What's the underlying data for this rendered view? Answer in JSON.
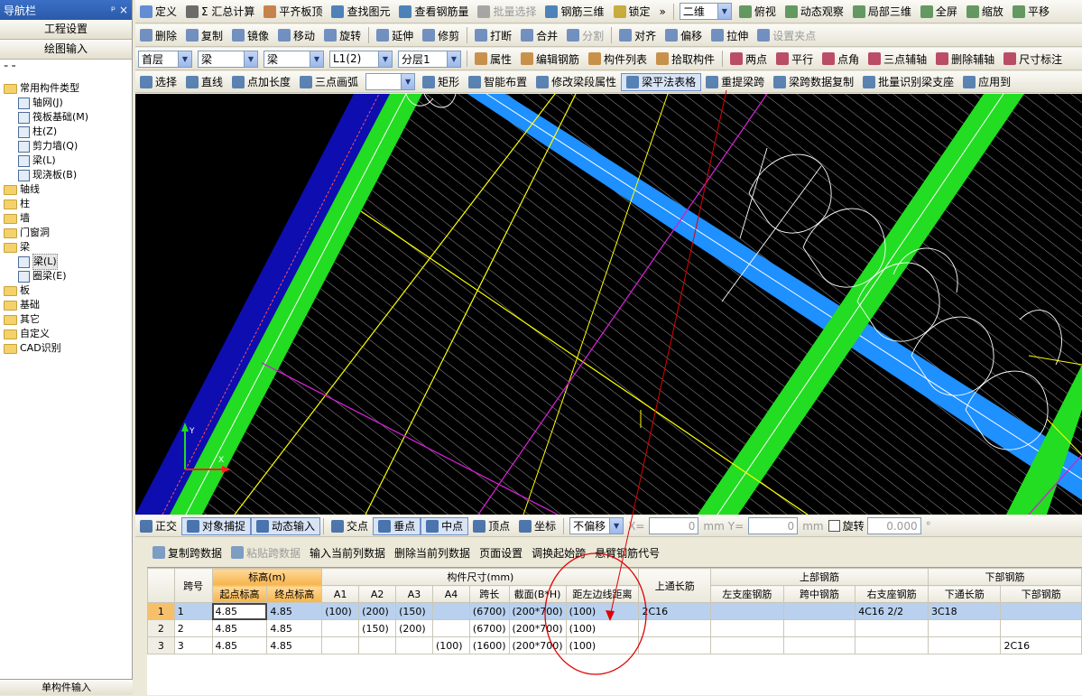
{
  "nav": {
    "title": "导航栏",
    "pin": "ᵖ ×",
    "project_settings": "工程设置",
    "drawing_input": "绘图输入",
    "single_component_input": "单构件输入",
    "tree": [
      {
        "label": "常用构件类型",
        "kind": "folder",
        "level": 0
      },
      {
        "label": "轴网(J)",
        "kind": "item",
        "level": 1
      },
      {
        "label": "筏板基础(M)",
        "kind": "item",
        "level": 1
      },
      {
        "label": "柱(Z)",
        "kind": "item",
        "level": 1
      },
      {
        "label": "剪力墙(Q)",
        "kind": "item",
        "level": 1
      },
      {
        "label": "梁(L)",
        "kind": "item",
        "level": 1
      },
      {
        "label": "现浇板(B)",
        "kind": "item",
        "level": 1
      },
      {
        "label": "轴线",
        "kind": "folder",
        "level": 0
      },
      {
        "label": "柱",
        "kind": "folder",
        "level": 0
      },
      {
        "label": "墙",
        "kind": "folder",
        "level": 0
      },
      {
        "label": "门窗洞",
        "kind": "folder",
        "level": 0
      },
      {
        "label": "梁",
        "kind": "folder",
        "level": 0
      },
      {
        "label": "梁(L)",
        "kind": "item",
        "level": 1,
        "selected": true
      },
      {
        "label": "圈梁(E)",
        "kind": "item",
        "level": 1
      },
      {
        "label": "板",
        "kind": "folder",
        "level": 0
      },
      {
        "label": "基础",
        "kind": "folder",
        "level": 0
      },
      {
        "label": "其它",
        "kind": "folder",
        "level": 0
      },
      {
        "label": "自定义",
        "kind": "folder",
        "level": 0
      },
      {
        "label": "CAD识别",
        "kind": "folder",
        "level": 0
      }
    ]
  },
  "toolbar1": [
    "定义",
    "Σ 汇总计算",
    "平齐板顶",
    "查找图元",
    "查看钢筋量",
    "批量选择",
    "钢筋三维",
    "锁定"
  ],
  "toolbar1_right": {
    "view_combo": "二维",
    "view_items": [
      "俯视",
      "动态观察",
      "局部三维",
      "全屏",
      "缩放",
      "平移"
    ]
  },
  "toolbar2": [
    "删除",
    "复制",
    "镜像",
    "移动",
    "旋转",
    "延伸",
    "修剪",
    "打断",
    "合并",
    "分割",
    "对齐",
    "偏移",
    "拉伸",
    "设置夹点"
  ],
  "toolbar3": {
    "floor": "首层",
    "type": "梁",
    "sub": "梁",
    "component": "L1(2)",
    "layer": "分层1",
    "buttons": [
      "属性",
      "编辑钢筋",
      "构件列表",
      "拾取构件",
      "两点",
      "平行",
      "点角",
      "三点辅轴",
      "删除辅轴",
      "尺寸标注"
    ]
  },
  "toolbar4": [
    "选择",
    "直线",
    "点加长度",
    "三点画弧",
    "矩形",
    "智能布置",
    "修改梁段属性",
    "梁平法表格",
    "重提梁跨",
    "梁跨数据复制",
    "批量识别梁支座",
    "应用到"
  ],
  "snapbar": {
    "items": [
      "正交",
      "对象捕捉",
      "动态输入",
      "交点",
      "垂点",
      "中点",
      "顶点",
      "坐标"
    ],
    "offset": "不偏移",
    "x_label": "X=",
    "x_val": "0",
    "unit": "mm",
    "y_label": "Y=",
    "y_val": "0",
    "rotate": "旋转",
    "rotate_val": "0.000",
    "deg": "°"
  },
  "table_toolbar": [
    "复制跨数据",
    "粘贴跨数据",
    "输入当前列数据",
    "删除当前列数据",
    "页面设置",
    "调换起始跨",
    "悬臂钢筋代号"
  ],
  "table": {
    "h_span": "跨号",
    "h_elev": "标高(m)",
    "h_dim": "构件尺寸(mm)",
    "h_top_through": "上通长筋",
    "h_top": "上部钢筋",
    "h_bottom": "下部钢筋",
    "sub": [
      "起点标高",
      "终点标高",
      "A1",
      "A2",
      "A3",
      "A4",
      "跨长",
      "截面(B*H)",
      "距左边线距离",
      "",
      "左支座钢筋",
      "跨中钢筋",
      "右支座钢筋",
      "下通长筋",
      "下部钢筋"
    ],
    "rows": [
      [
        "1",
        "1",
        "4.85",
        "4.85",
        "(100)",
        "(200)",
        "(150)",
        "",
        "(6700)",
        "(200*700)",
        "(100)",
        "2C16",
        "",
        "",
        "4C16 2/2",
        "3C18",
        ""
      ],
      [
        "2",
        "2",
        "4.85",
        "4.85",
        "",
        "(150)",
        "(200)",
        "",
        "(6700)",
        "(200*700)",
        "(100)",
        "",
        "",
        "",
        "",
        "",
        ""
      ],
      [
        "3",
        "3",
        "4.85",
        "4.85",
        "",
        "",
        "",
        "(100)",
        "(1600)",
        "(200*700)",
        "(100)",
        "",
        "",
        "",
        "",
        "",
        "2C16"
      ]
    ]
  },
  "colors": {
    "blue_beam": "#1e90ff",
    "green_beam": "#22dd22",
    "dark_blue": "#0d0db0",
    "yellow": "#ffff00",
    "magenta": "#d020d0",
    "annotation": "#e00000"
  }
}
